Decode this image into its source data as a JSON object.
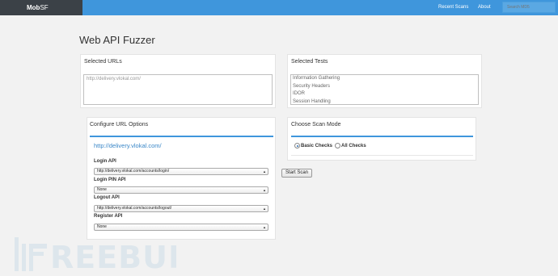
{
  "navbar": {
    "brand_bold": "Mob",
    "brand_rest": "SF",
    "links": [
      "Recent Scans",
      "About"
    ],
    "search_placeholder": "Search MD5"
  },
  "page": {
    "title": "Web API Fuzzer"
  },
  "selected_urls": {
    "title": "Selected URLs",
    "value": "http://delivery.vlokal.com/"
  },
  "selected_tests": {
    "title": "Selected Tests",
    "options": [
      "Information Gathering",
      "Security Headers",
      "IDOR",
      "Session Handling"
    ]
  },
  "url_options": {
    "title": "Configure URL Options",
    "url": "http://delivery.vlokal.com/",
    "fields": [
      {
        "label": "Login API",
        "value": "http://delivery.vlokal.com/accounts/login/"
      },
      {
        "label": "Login PIN API",
        "value": "None"
      },
      {
        "label": "Logout API",
        "value": "http://delivery.vlokal.com/accounts/logout/"
      },
      {
        "label": "Register API",
        "value": "None"
      }
    ]
  },
  "scan_mode": {
    "title": "Choose Scan Mode",
    "options": [
      "Basic Checks",
      "All Checks"
    ],
    "selected": "Basic Checks"
  },
  "start_button": "Start Scan",
  "watermark": "FREEBUF",
  "colors": {
    "navbar": "#3f96dc",
    "brand_bg": "#3b4147",
    "link": "#3a87c8"
  }
}
